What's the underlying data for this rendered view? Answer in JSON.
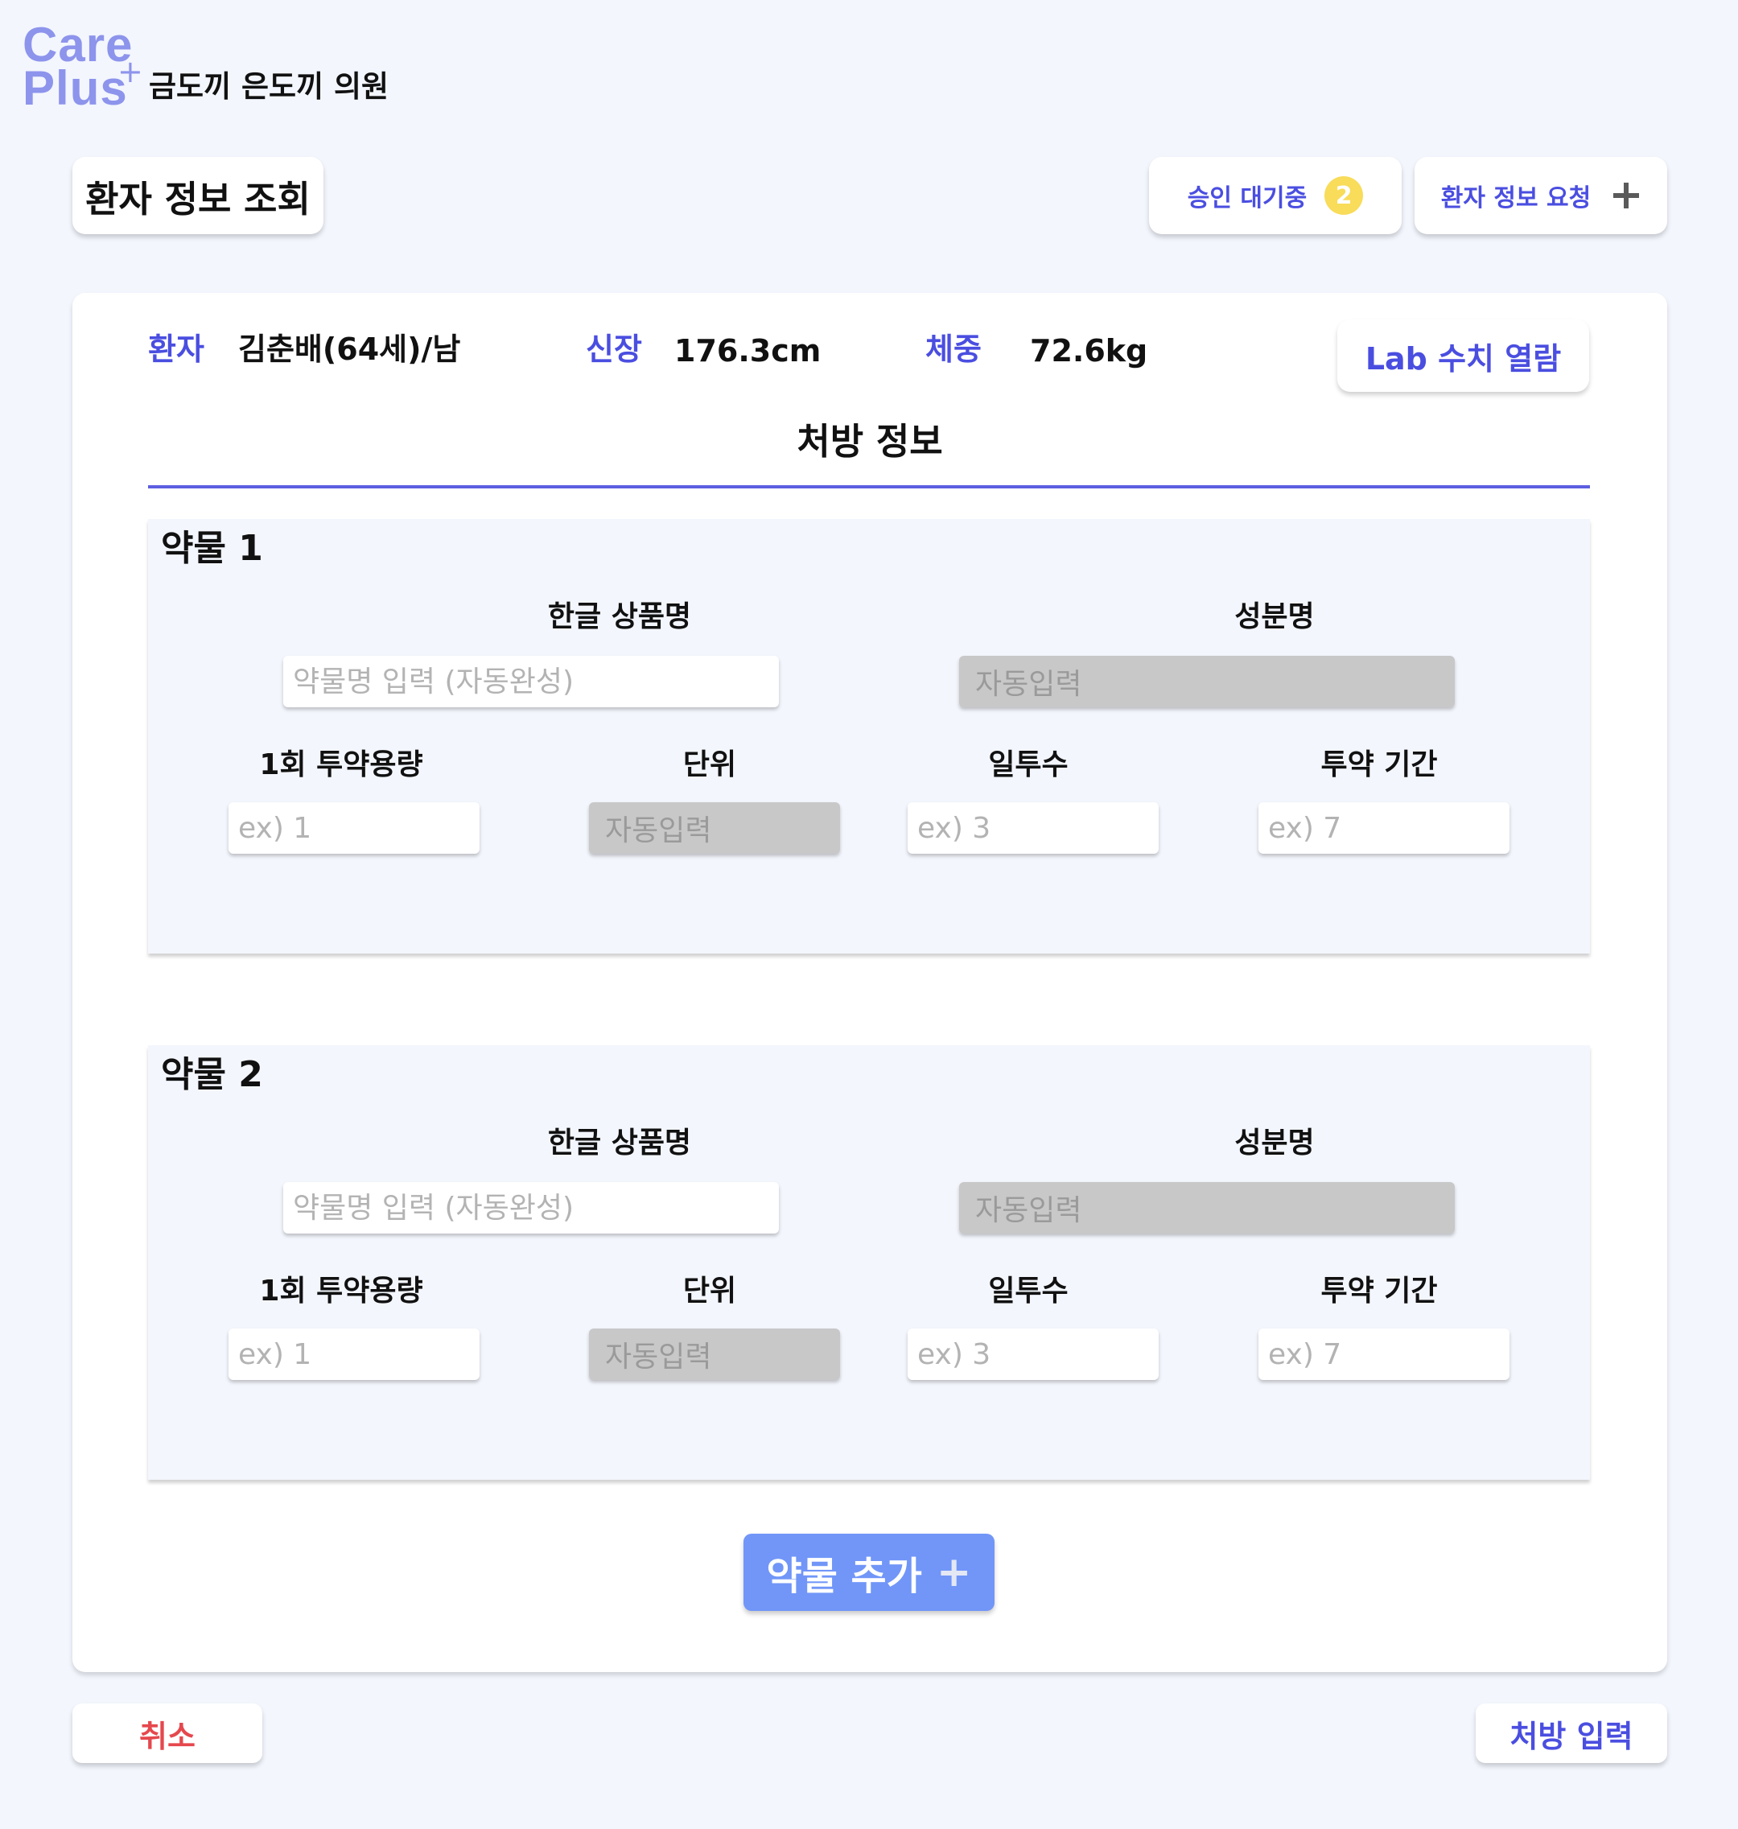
{
  "logo": {
    "line1": "Care",
    "line2": "Plus",
    "cross": "+"
  },
  "clinic_name": "금도끼 은도끼 의원",
  "header": {
    "page_title": "환자 정보 조회",
    "pending_label": "승인 대기중",
    "pending_count": "2",
    "request_label": "환자 정보 요청",
    "request_icon": "plus-icon"
  },
  "patient": {
    "patient_label": "환자",
    "patient_value": "김춘배(64세)/남",
    "height_label": "신장",
    "height_value": "176.3cm",
    "weight_label": "체중",
    "weight_value": "72.6kg",
    "lab_button": "Lab 수치 열람"
  },
  "section_title": "처방 정보",
  "drugs": [
    {
      "title": "약물 1",
      "name_label": "한글 상품명",
      "name_placeholder": "약물명 입력 (자동완성)",
      "ingredient_label": "성분명",
      "ingredient_value": "자동입력",
      "dose_label": "1회 투약용량",
      "dose_placeholder": "ex) 1",
      "unit_label": "단위",
      "unit_value": "자동입력",
      "daily_label": "일투수",
      "daily_placeholder": "ex) 3",
      "period_label": "투약 기간",
      "period_placeholder": "ex) 7"
    },
    {
      "title": "약물 2",
      "name_label": "한글 상품명",
      "name_placeholder": "약물명 입력 (자동완성)",
      "ingredient_label": "성분명",
      "ingredient_value": "자동입력",
      "dose_label": "1회 투약용량",
      "dose_placeholder": "ex) 1",
      "unit_label": "단위",
      "unit_value": "자동입력",
      "daily_label": "일투수",
      "daily_placeholder": "ex) 3",
      "period_label": "투약 기간",
      "period_placeholder": "ex) 7"
    }
  ],
  "add_drug_label": "약물 추가",
  "add_drug_icon": "+",
  "footer": {
    "cancel_label": "취소",
    "submit_label": "처방 입력"
  },
  "colors": {
    "accent": "#4a4ee0",
    "logo": "#8d94ec",
    "add_button": "#7196f8",
    "badge": "#f8dc5a",
    "cancel": "#e5484d",
    "background": "#f3f6fd"
  }
}
